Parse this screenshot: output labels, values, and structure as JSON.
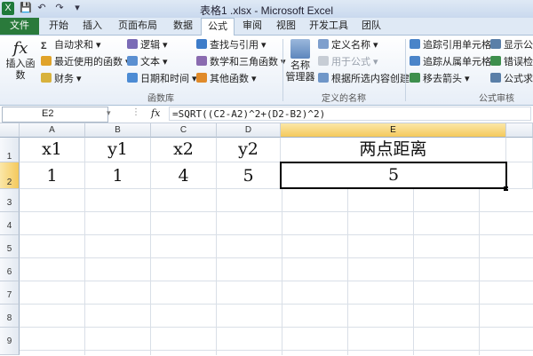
{
  "window": {
    "title": "表格1 .xlsx - Microsoft Excel"
  },
  "quick_access": [
    "X",
    "💾",
    "↶",
    "↷",
    "▾"
  ],
  "tabs": [
    "文件",
    "开始",
    "插入",
    "页面布局",
    "数据",
    "公式",
    "审阅",
    "视图",
    "开发工具",
    "团队"
  ],
  "ribbon": {
    "insert_function": {
      "icon": "fx",
      "label": "插入函数"
    },
    "library": {
      "autosum": "自动求和 ▾",
      "recent": "最近使用的函数 ▾",
      "financial": "财务 ▾",
      "logical": "逻辑 ▾",
      "text": "文本 ▾",
      "datetime": "日期和时间 ▾",
      "lookup": "查找与引用 ▾",
      "math": "数学和三角函数 ▾",
      "more": "其他函数 ▾",
      "group_label": "函数库"
    },
    "names": {
      "manager_label1": "名称",
      "manager_label2": "管理器",
      "define": "定义名称 ▾",
      "use_in_formula": "用于公式 ▾",
      "create_from_sel": "根据所选内容创建",
      "group_label": "定义的名称"
    },
    "audit": {
      "trace_precedents": "追踪引用单元格",
      "trace_dependents": "追踪从属单元格",
      "remove_arrows": "移去箭头 ▾",
      "show_formulas": "显示公",
      "error_check": "错误检",
      "evaluate": "公式求",
      "group_label": "公式审核"
    }
  },
  "formula_bar": {
    "name_box": "E2",
    "fx": "fx",
    "formula": "=SQRT((C2-A2)^2+(D2-B2)^2)"
  },
  "grid": {
    "columns": [
      "A",
      "B",
      "C",
      "D",
      "E"
    ],
    "rows": [
      "1",
      "2",
      "3",
      "4",
      "5",
      "6",
      "7",
      "8",
      "9"
    ],
    "cells": {
      "A1": "x1",
      "B1": "y1",
      "C1": "x2",
      "D1": "y2",
      "E1": "两点距离",
      "A2": "1",
      "B2": "1",
      "C2": "4",
      "D2": "5",
      "E2": "5"
    },
    "selected_cell": "E2"
  },
  "colors": {
    "file_tab": "#2a7a3b",
    "selection_header": "#f4c95c"
  }
}
